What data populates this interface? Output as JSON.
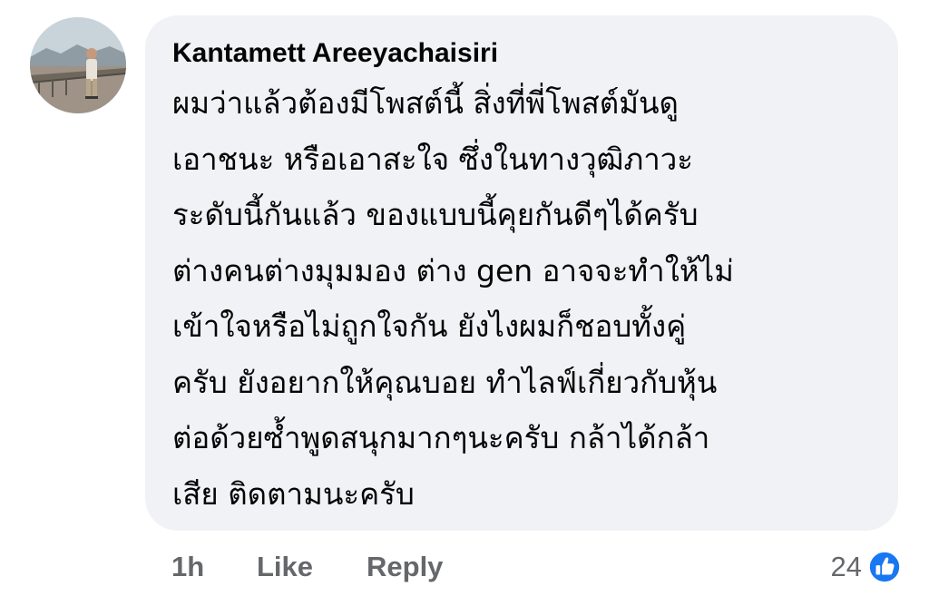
{
  "comment": {
    "author": "Kantamett Areeyachaisiri",
    "body_lines": [
      "ผมว่าแล้วต้องมีโพสต์นี้ สิ่งที่พี่โพสต์มันดู",
      "เอาชนะ หรือเอาสะใจ ซึ่งในทางวุฒิภาวะ",
      "ระดับนี้กันแล้ว ของแบบนี้คุยกันดีๆได้ครับ",
      "ต่างคนต่างมุมมอง ต่าง gen อาจจะทำให้ไม่",
      "เข้าใจหรือไม่ถูกใจกัน ยังไงผมก็ชอบทั้งคู่",
      "ครับ ยังอยากให้คุณบอย ทำไลฟ์เกี่ยวกับหุ้น",
      "ต่อด้วยซ้ำพูดสนุกมากๆนะครับ กล้าได้กล้า",
      "เสีย ติดตามนะครับ"
    ]
  },
  "footer": {
    "timestamp": "1h",
    "like_label": "Like",
    "reply_label": "Reply",
    "reaction_count": "24",
    "reaction_icon": "like-thumbs-up-icon"
  },
  "colors": {
    "bubble_background": "#f0f2f5",
    "text_primary": "#050505",
    "text_secondary": "#65676b",
    "like_blue": "#1877f2"
  }
}
